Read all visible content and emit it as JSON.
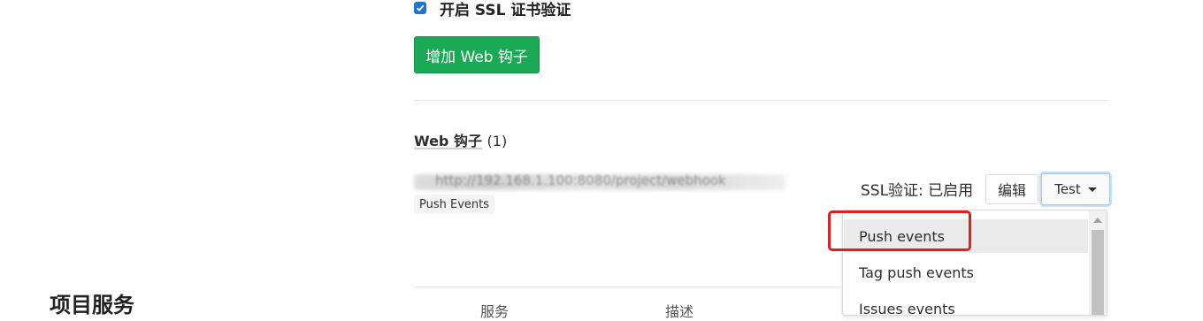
{
  "ssl": {
    "checked": true,
    "label": "开启 SSL 证书验证"
  },
  "add_button": {
    "label": "增加 Web 钩子"
  },
  "hooks": {
    "title": "Web 钩子",
    "count": "(1)",
    "items": [
      {
        "url": "http://192.168.1.100:8080/project/webhook",
        "events": [
          "Push Events"
        ],
        "ssl_status": "SSL验证: 已启用",
        "edit_label": "编辑",
        "test_label": "Test"
      }
    ]
  },
  "test_menu": {
    "items": [
      "Push events",
      "Tag push events",
      "Issues events"
    ],
    "active_index": 0
  },
  "project_services": {
    "title": "项目服务",
    "columns": [
      "服务",
      "描述"
    ]
  },
  "colors": {
    "primary_green": "#1aaa55",
    "checkbox_blue": "#1f75cb",
    "highlight_red": "#e02020"
  }
}
